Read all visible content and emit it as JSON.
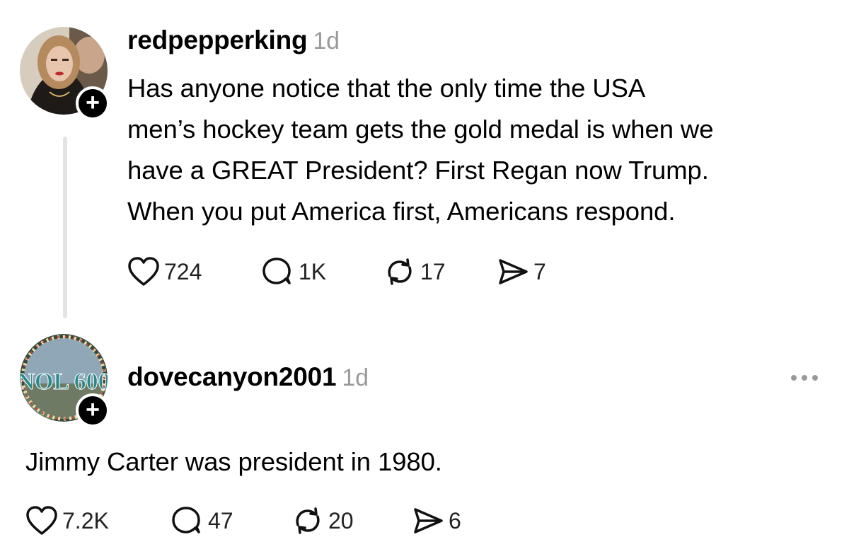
{
  "posts": [
    {
      "username": "redpepperking",
      "time": "1d",
      "text_lines": [
        "Has anyone notice that the only time the USA",
        "men’s hockey team gets the gold medal is when we",
        "have a GREAT President? First Regan now Trump.",
        "When you put America first, Americans respond."
      ],
      "likes": "724",
      "replies": "1K",
      "reposts": "17",
      "shares": "7"
    },
    {
      "username": "dovecanyon2001",
      "time": "1d",
      "avatar_text": "NOL 600",
      "text": "Jimmy Carter was president in 1980.",
      "likes": "7.2K",
      "replies": "47",
      "reposts": "20",
      "shares": "6"
    }
  ],
  "icons": {
    "like": "heart-icon",
    "reply": "comment-icon",
    "repost": "repost-icon",
    "share": "send-icon",
    "follow": "plus-icon",
    "more": "more-icon"
  },
  "colors": {
    "text": "#000000",
    "muted": "#9a9a9a",
    "thread_line": "#e3e3e3",
    "background": "#ffffff"
  }
}
